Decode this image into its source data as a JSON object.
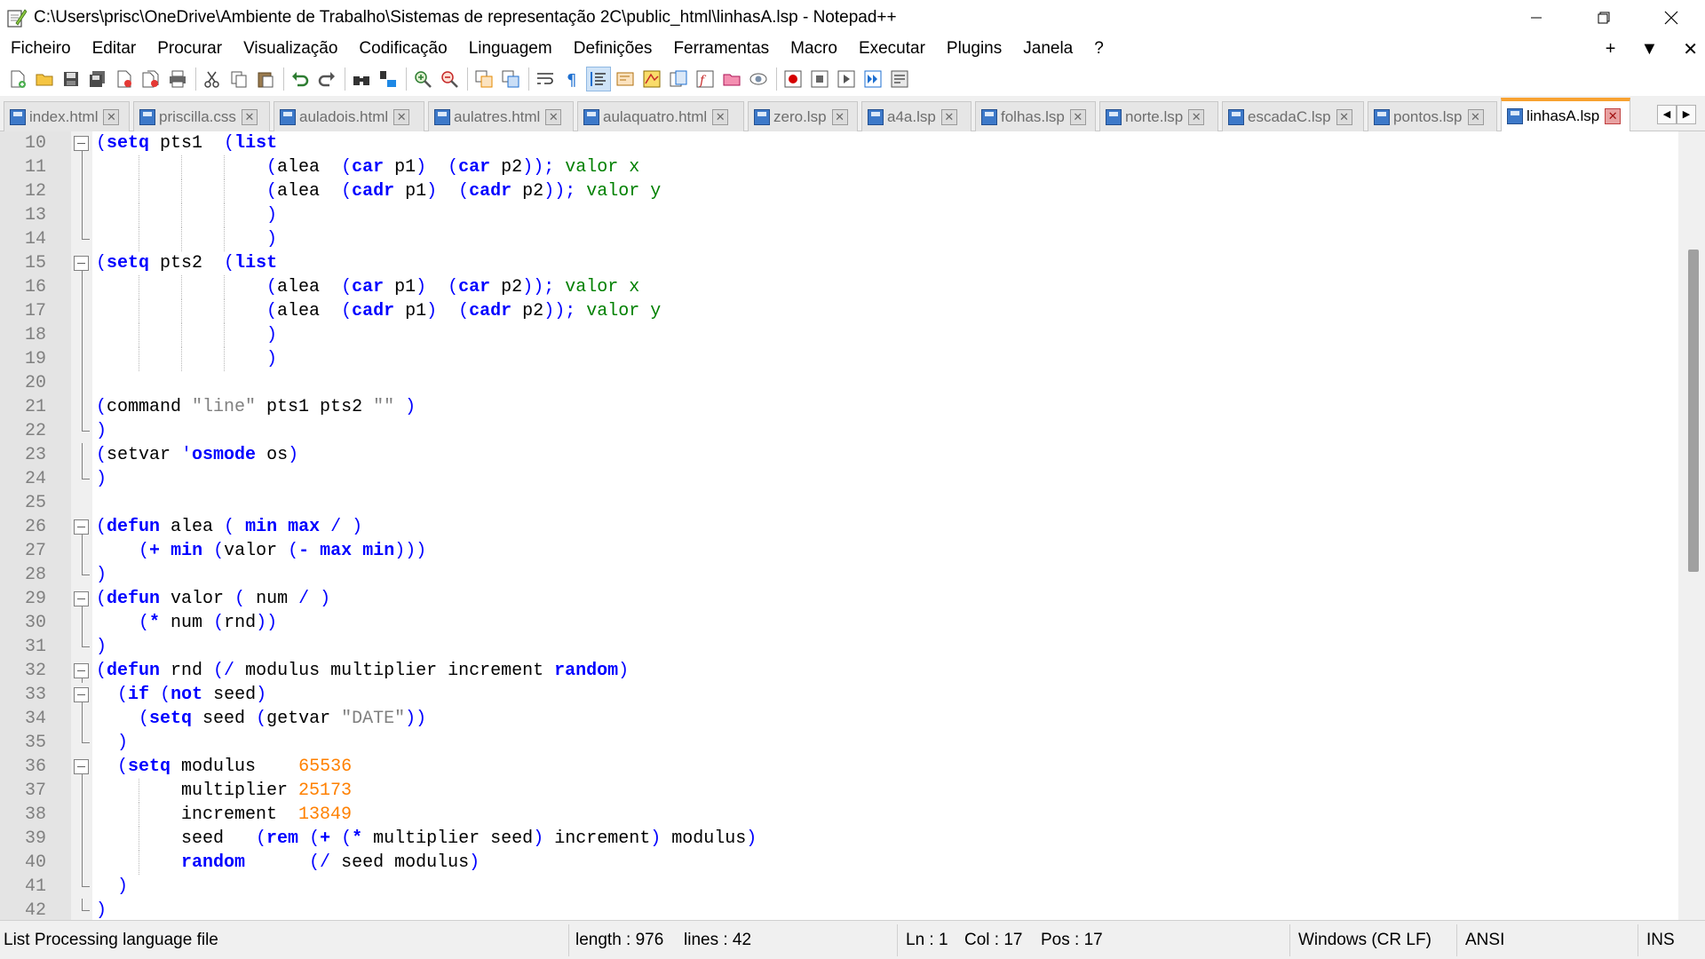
{
  "window": {
    "title": "C:\\Users\\prisc\\OneDrive\\Ambiente de Trabalho\\Sistemas de representação 2C\\public_html\\linhasA.lsp - Notepad++",
    "minimize": "—",
    "restore": "❐",
    "close": "✕"
  },
  "menu": {
    "items": [
      "Ficheiro",
      "Editar",
      "Procurar",
      "Visualização",
      "Codificação",
      "Linguagem",
      "Definições",
      "Ferramentas",
      "Macro",
      "Executar",
      "Plugins",
      "Janela",
      "?"
    ],
    "right": [
      "+",
      "▼",
      "✕"
    ]
  },
  "toolbar": {
    "icons": [
      "new-file-icon",
      "open-file-icon",
      "save-icon",
      "save-all-icon",
      "close-icon",
      "close-all-icon",
      "print-icon",
      "cut-icon",
      "copy-icon",
      "paste-icon",
      "undo-icon",
      "redo-icon",
      "find-icon",
      "replace-icon",
      "zoom-in-icon",
      "zoom-out-icon",
      "sync-vertical-icon",
      "sync-horizontal-icon",
      "word-wrap-icon",
      "show-all-characters-icon",
      "indent-guide-icon",
      "user-language-icon",
      "doc-map-icon",
      "doc-list-icon",
      "function-list-icon",
      "folder-workspace-icon",
      "monitoring-icon",
      "record-macro-icon",
      "stop-macro-icon",
      "play-macro-icon",
      "run-macro-multiple-icon",
      "save-macro-icon"
    ]
  },
  "tabs": [
    {
      "label": "index.html",
      "active": false
    },
    {
      "label": "priscilla.css",
      "active": false
    },
    {
      "label": "auladois.html",
      "active": false
    },
    {
      "label": "aulatres.html",
      "active": false
    },
    {
      "label": "aulaquatro.html",
      "active": false
    },
    {
      "label": "zero.lsp",
      "active": false
    },
    {
      "label": "a4a.lsp",
      "active": false
    },
    {
      "label": "folhas.lsp",
      "active": false
    },
    {
      "label": "norte.lsp",
      "active": false
    },
    {
      "label": "escadaC.lsp",
      "active": false
    },
    {
      "label": "pontos.lsp",
      "active": false
    },
    {
      "label": "linhasA.lsp",
      "active": true
    }
  ],
  "tab_scroll": {
    "left": "◀",
    "right": "▶"
  },
  "editor": {
    "lines": [
      {
        "num": "10",
        "fold": "open",
        "segs": [
          [
            "p",
            "("
          ],
          [
            "k",
            "setq"
          ],
          [
            "t",
            " pts1  "
          ],
          [
            "p",
            "("
          ],
          [
            "k",
            "list"
          ]
        ]
      },
      {
        "num": "11",
        "fold": "line",
        "segs": [
          [
            "t",
            "                "
          ],
          [
            "p",
            "("
          ],
          [
            "t",
            "alea  "
          ],
          [
            "p",
            "("
          ],
          [
            "k",
            "car"
          ],
          [
            "t",
            " p1"
          ],
          [
            "p",
            ")"
          ],
          [
            "t",
            "  "
          ],
          [
            "p",
            "("
          ],
          [
            "k",
            "car"
          ],
          [
            "t",
            " p2"
          ],
          [
            "p",
            "));"
          ],
          [
            "c",
            " valor x"
          ]
        ]
      },
      {
        "num": "12",
        "fold": "line",
        "segs": [
          [
            "t",
            "                "
          ],
          [
            "p",
            "("
          ],
          [
            "t",
            "alea  "
          ],
          [
            "p",
            "("
          ],
          [
            "k",
            "cadr"
          ],
          [
            "t",
            " p1"
          ],
          [
            "p",
            ")"
          ],
          [
            "t",
            "  "
          ],
          [
            "p",
            "("
          ],
          [
            "k",
            "cadr"
          ],
          [
            "t",
            " p2"
          ],
          [
            "p",
            "));"
          ],
          [
            "c",
            " valor y"
          ]
        ]
      },
      {
        "num": "13",
        "fold": "line",
        "segs": [
          [
            "t",
            "                "
          ],
          [
            "p",
            ")"
          ]
        ]
      },
      {
        "num": "14",
        "fold": "end",
        "segs": [
          [
            "t",
            "                "
          ],
          [
            "p",
            ")"
          ]
        ]
      },
      {
        "num": "15",
        "fold": "open",
        "segs": [
          [
            "p",
            "("
          ],
          [
            "k",
            "setq"
          ],
          [
            "t",
            " pts2  "
          ],
          [
            "p",
            "("
          ],
          [
            "k",
            "list"
          ]
        ]
      },
      {
        "num": "16",
        "fold": "line",
        "segs": [
          [
            "t",
            "                "
          ],
          [
            "p",
            "("
          ],
          [
            "t",
            "alea  "
          ],
          [
            "p",
            "("
          ],
          [
            "k",
            "car"
          ],
          [
            "t",
            " p1"
          ],
          [
            "p",
            ")"
          ],
          [
            "t",
            "  "
          ],
          [
            "p",
            "("
          ],
          [
            "k",
            "car"
          ],
          [
            "t",
            " p2"
          ],
          [
            "p",
            "));"
          ],
          [
            "c",
            " valor x"
          ]
        ]
      },
      {
        "num": "17",
        "fold": "line",
        "segs": [
          [
            "t",
            "                "
          ],
          [
            "p",
            "("
          ],
          [
            "t",
            "alea  "
          ],
          [
            "p",
            "("
          ],
          [
            "k",
            "cadr"
          ],
          [
            "t",
            " p1"
          ],
          [
            "p",
            ")"
          ],
          [
            "t",
            "  "
          ],
          [
            "p",
            "("
          ],
          [
            "k",
            "cadr"
          ],
          [
            "t",
            " p2"
          ],
          [
            "p",
            "));"
          ],
          [
            "c",
            " valor y"
          ]
        ]
      },
      {
        "num": "18",
        "fold": "line",
        "segs": [
          [
            "t",
            "                "
          ],
          [
            "p",
            ")"
          ]
        ]
      },
      {
        "num": "19",
        "fold": "line",
        "segs": [
          [
            "t",
            "                "
          ],
          [
            "p",
            ")"
          ]
        ]
      },
      {
        "num": "20",
        "fold": "line",
        "segs": []
      },
      {
        "num": "21",
        "fold": "line",
        "segs": [
          [
            "p",
            "("
          ],
          [
            "t",
            "command "
          ],
          [
            "s",
            "\"line\""
          ],
          [
            "t",
            " pts1 pts2 "
          ],
          [
            "s",
            "\"\""
          ],
          [
            "t",
            " "
          ],
          [
            "p",
            ")"
          ]
        ]
      },
      {
        "num": "22",
        "fold": "end",
        "segs": [
          [
            "p",
            ")"
          ]
        ]
      },
      {
        "num": "23",
        "fold": "line",
        "segs": [
          [
            "p",
            "("
          ],
          [
            "t",
            "setvar "
          ],
          [
            "p",
            "'"
          ],
          [
            "k",
            "osmode"
          ],
          [
            "t",
            " os"
          ],
          [
            "p",
            ")"
          ]
        ]
      },
      {
        "num": "24",
        "fold": "end",
        "segs": [
          [
            "p",
            ")"
          ]
        ]
      },
      {
        "num": "25",
        "fold": "none",
        "segs": []
      },
      {
        "num": "26",
        "fold": "open",
        "segs": [
          [
            "p",
            "("
          ],
          [
            "k",
            "defun"
          ],
          [
            "t",
            " alea "
          ],
          [
            "p",
            "("
          ],
          [
            "t",
            " "
          ],
          [
            "k",
            "min"
          ],
          [
            "t",
            " "
          ],
          [
            "k",
            "max"
          ],
          [
            "t",
            " "
          ],
          [
            "p",
            "/"
          ],
          [
            "t",
            " "
          ],
          [
            "p",
            ")"
          ]
        ]
      },
      {
        "num": "27",
        "fold": "line",
        "segs": [
          [
            "t",
            "    "
          ],
          [
            "p",
            "("
          ],
          [
            "k",
            "+"
          ],
          [
            "t",
            " "
          ],
          [
            "k",
            "min"
          ],
          [
            "t",
            " "
          ],
          [
            "p",
            "("
          ],
          [
            "t",
            "valor "
          ],
          [
            "p",
            "("
          ],
          [
            "k",
            "-"
          ],
          [
            "t",
            " "
          ],
          [
            "k",
            "max"
          ],
          [
            "t",
            " "
          ],
          [
            "k",
            "min"
          ],
          [
            "p",
            ")))"
          ]
        ]
      },
      {
        "num": "28",
        "fold": "end",
        "segs": [
          [
            "p",
            ")"
          ]
        ]
      },
      {
        "num": "29",
        "fold": "open",
        "segs": [
          [
            "p",
            "("
          ],
          [
            "k",
            "defun"
          ],
          [
            "t",
            " valor "
          ],
          [
            "p",
            "("
          ],
          [
            "t",
            " num "
          ],
          [
            "p",
            "/"
          ],
          [
            "t",
            " "
          ],
          [
            "p",
            ")"
          ]
        ]
      },
      {
        "num": "30",
        "fold": "line",
        "segs": [
          [
            "t",
            "    "
          ],
          [
            "p",
            "("
          ],
          [
            "k",
            "*"
          ],
          [
            "t",
            " num "
          ],
          [
            "p",
            "("
          ],
          [
            "t",
            "rnd"
          ],
          [
            "p",
            "))"
          ]
        ]
      },
      {
        "num": "31",
        "fold": "end",
        "segs": [
          [
            "p",
            ")"
          ]
        ]
      },
      {
        "num": "32",
        "fold": "open",
        "segs": [
          [
            "p",
            "("
          ],
          [
            "k",
            "defun"
          ],
          [
            "t",
            " rnd "
          ],
          [
            "p",
            "(/"
          ],
          [
            "t",
            " modulus multiplier increment "
          ],
          [
            "k",
            "random"
          ],
          [
            "p",
            ")"
          ]
        ]
      },
      {
        "num": "33",
        "fold": "open",
        "segs": [
          [
            "t",
            "  "
          ],
          [
            "p",
            "("
          ],
          [
            "k",
            "if"
          ],
          [
            "t",
            " "
          ],
          [
            "p",
            "("
          ],
          [
            "k",
            "not"
          ],
          [
            "t",
            " seed"
          ],
          [
            "p",
            ")"
          ]
        ]
      },
      {
        "num": "34",
        "fold": "line",
        "segs": [
          [
            "t",
            "    "
          ],
          [
            "p",
            "("
          ],
          [
            "k",
            "setq"
          ],
          [
            "t",
            " seed "
          ],
          [
            "p",
            "("
          ],
          [
            "t",
            "getvar "
          ],
          [
            "s",
            "\"DATE\""
          ],
          [
            "p",
            "))"
          ]
        ]
      },
      {
        "num": "35",
        "fold": "end",
        "segs": [
          [
            "t",
            "  "
          ],
          [
            "p",
            ")"
          ]
        ]
      },
      {
        "num": "36",
        "fold": "open",
        "segs": [
          [
            "t",
            "  "
          ],
          [
            "p",
            "("
          ],
          [
            "k",
            "setq"
          ],
          [
            "t",
            " modulus    "
          ],
          [
            "n",
            "65536"
          ]
        ]
      },
      {
        "num": "37",
        "fold": "line",
        "segs": [
          [
            "t",
            "        multiplier "
          ],
          [
            "n",
            "25173"
          ]
        ]
      },
      {
        "num": "38",
        "fold": "line",
        "segs": [
          [
            "t",
            "        increment  "
          ],
          [
            "n",
            "13849"
          ]
        ]
      },
      {
        "num": "39",
        "fold": "line",
        "segs": [
          [
            "t",
            "        seed   "
          ],
          [
            "p",
            "("
          ],
          [
            "k",
            "rem"
          ],
          [
            "t",
            " "
          ],
          [
            "p",
            "("
          ],
          [
            "k",
            "+"
          ],
          [
            "t",
            " "
          ],
          [
            "p",
            "("
          ],
          [
            "k",
            "*"
          ],
          [
            "t",
            " multiplier seed"
          ],
          [
            "p",
            ")"
          ],
          [
            "t",
            " increment"
          ],
          [
            "p",
            ")"
          ],
          [
            "t",
            " modulus"
          ],
          [
            "p",
            ")"
          ]
        ]
      },
      {
        "num": "40",
        "fold": "line",
        "segs": [
          [
            "t",
            "        "
          ],
          [
            "k",
            "random"
          ],
          [
            "t",
            "      "
          ],
          [
            "p",
            "(/"
          ],
          [
            "t",
            " seed modulus"
          ],
          [
            "p",
            ")"
          ]
        ]
      },
      {
        "num": "41",
        "fold": "end",
        "segs": [
          [
            "t",
            "  "
          ],
          [
            "p",
            ")"
          ]
        ]
      },
      {
        "num": "42",
        "fold": "end",
        "segs": [
          [
            "p",
            ")"
          ]
        ]
      }
    ]
  },
  "status": {
    "file_type": "List Processing language file",
    "length": "length : 976",
    "lines": "lines : 42",
    "ln": "Ln : 1",
    "col": "Col : 17",
    "pos": "Pos : 17",
    "eol": "Windows (CR LF)",
    "encoding": "ANSI",
    "mode": "INS"
  },
  "colors": {
    "keyword": "#0000ff",
    "comment": "#008000",
    "number": "#ff8000",
    "string": "#808080",
    "active_tab_accent": "#f8a230"
  }
}
